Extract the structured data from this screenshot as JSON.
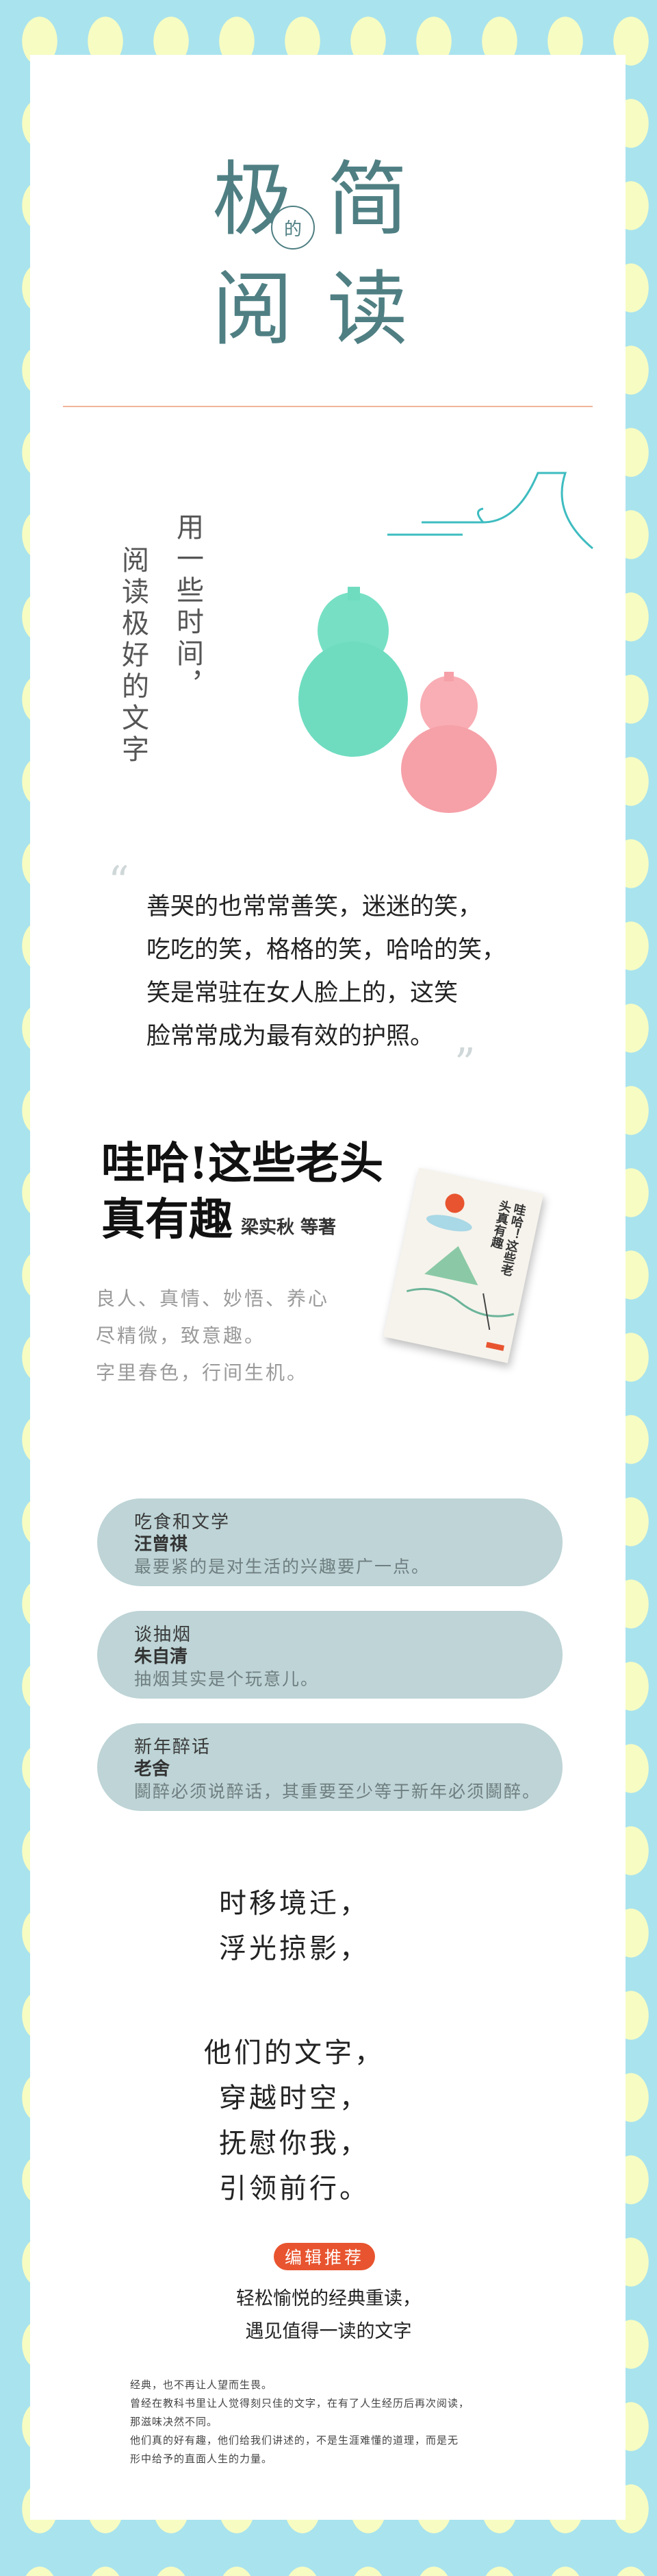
{
  "title": {
    "char1": "极",
    "char2": "简",
    "char3": "阅",
    "char4": "读",
    "connector": "的"
  },
  "vertical_slogan": {
    "line1": "用一些时间，",
    "line2": "阅读极好的文字"
  },
  "quote": {
    "lines": [
      "善哭的也常常善笑，迷迷的笑，",
      "吃吃的笑，格格的笑，哈哈的笑，",
      "笑是常驻在女人脸上的，这笑",
      "脸常常成为最有效的护照。"
    ]
  },
  "book": {
    "title_line1": "哇哈!这些老头",
    "title_line2": "真有趣",
    "author": "梁实秋  等著",
    "cover_title": "哇哈！这些老头真有趣",
    "taglines": [
      "良人、真情、妙悟、养心",
      "尽精微，致意趣。",
      "字里春色，行间生机。"
    ]
  },
  "essays": [
    {
      "title": "吃食和文学",
      "author": "汪曾祺",
      "excerpt": "最要紧的是对生活的兴趣要广一点。"
    },
    {
      "title": "谈抽烟",
      "author": "朱自清",
      "excerpt": "抽烟其实是个玩意儿。"
    },
    {
      "title": "新年醉话",
      "author": "老舍",
      "excerpt": "鬬醉必须说醉话，其重要至少等于新年必须鬬醉。"
    }
  ],
  "poem": {
    "stanza1": [
      "时移境迁，",
      "浮光掠影，"
    ],
    "stanza2": [
      "他们的文字，",
      "穿越时空，",
      "抚慰你我，",
      "引领前行。"
    ]
  },
  "recommend": {
    "badge": "编辑推荐",
    "line1": "轻松愉悦的经典重读，",
    "line2": "遇见值得一读的文字"
  },
  "footer": {
    "lines": [
      "经典，也不再让人望而生畏。",
      "曾经在教科书里让人觉得刻只佳的文字，在有了人生经历后再次阅读，",
      "那滋味决然不同。",
      "他们真的好有趣，他们给我们讲述的，不是生涯难懂的道理，而是无",
      "形中给予的直面人生的力量。"
    ]
  },
  "colors": {
    "title_teal": "#4f7f83",
    "pill_bg": "#bed4d6",
    "badge_red": "#e8542f",
    "background_sky": "#a9e3ee",
    "gourd_green": "#6fdcc0",
    "gourd_pink": "#f6a0a8"
  }
}
